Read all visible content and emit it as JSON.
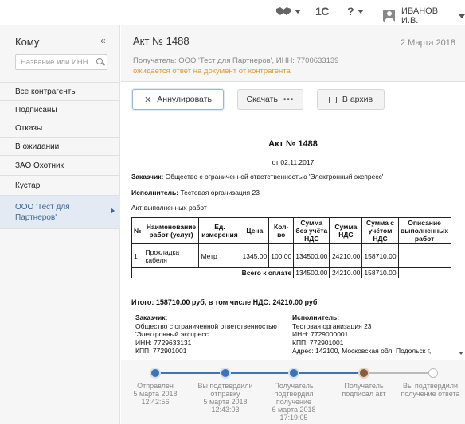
{
  "topbar": {
    "logo_1c": "1С",
    "help": "?",
    "user_name": "ИВАНОВ И.В."
  },
  "sidebar": {
    "title": "Кому",
    "collapse_icon": "«",
    "search_placeholder": "Название или ИНН",
    "items": [
      {
        "label": "Все контрагенты"
      },
      {
        "label": "Подписаны"
      },
      {
        "label": "Отказы"
      },
      {
        "label": "В ожидании"
      },
      {
        "label": "ЗАО Охотник"
      },
      {
        "label": "Кустар"
      },
      {
        "label": "ООО 'Тест для Партнеров'"
      }
    ]
  },
  "header": {
    "title": "Акт № 1488",
    "date": "2 Марта 2018",
    "recipient": "Получатель: ООО 'Тест для Партнеров', ИНН: 7700633139",
    "status": "ожидается ответ на документ от контрагента"
  },
  "actions": {
    "annul": "Аннулировать",
    "download": "Скачать",
    "archive": "В архив"
  },
  "document": {
    "title": "Акт № 1488",
    "date_line": "от 02.11.2017",
    "customer_label": "Заказчик:",
    "customer_value": "Общество с ограниченной ответственностью 'Электронный экспресс'",
    "executor_label": "Исполнитель:",
    "executor_value": "Тестовая организация 23",
    "subtitle": "Акт выполненных работ",
    "table": {
      "headers": [
        "№",
        "Наименование работ (услуг)",
        "Ед. измерения",
        "Цена",
        "Кол-во",
        "Сумма без учёта НДС",
        "Сумма НДС",
        "Сумма с учётом НДС",
        "Описание выполненных работ"
      ],
      "rows": [
        [
          "1",
          "Прокладка кабеля",
          "Метр",
          "1345.00",
          "100.00",
          "134500.00",
          "24210.00",
          "158710.00",
          ""
        ]
      ],
      "total_label": "Всего к оплате",
      "total_no_vat": "134500.00",
      "total_vat": "24210.00",
      "total_with_vat": "158710.00"
    },
    "grand_total": "Итого: 158710.00 руб, в том числе НДС: 24210.00 руб",
    "customer_block": {
      "label": "Заказчик:",
      "name1": "Общество с ограниченной ответственностью",
      "name2": "'Электронный экспресс'",
      "inn": "ИНН: 7729633131",
      "kpp": "КПП: 772901001"
    },
    "executor_block": {
      "label": "Исполнитель:",
      "name": "Тестовая организация 23",
      "inn": "ИНН: 7729000001",
      "kpp": "КПП: 772901001",
      "address": "Адрес: 142100, Московская обл, Подольск г,"
    }
  },
  "timeline": {
    "steps": [
      {
        "l1": "Отправлен",
        "l2": "5 марта 2018",
        "l3": "12:42:56",
        "l4": "",
        "state": "done"
      },
      {
        "l1": "Вы подтвердили",
        "l2": "отправку",
        "l3": "5 марта 2018",
        "l4": "12:43:03",
        "state": "done"
      },
      {
        "l1": "Получатель",
        "l2": "подтвердил",
        "l3": "получение",
        "l4": "6 марта 2018",
        "l5": "17:19:05",
        "state": "done"
      },
      {
        "l1": "Получатель",
        "l2": "подписал акт",
        "l3": "",
        "l4": "",
        "state": "current"
      },
      {
        "l1": "Вы подтвердили",
        "l2": "получение ответа",
        "l3": "",
        "l4": "",
        "state": "pending"
      }
    ]
  },
  "colors": {
    "accent_blue": "#3f73b8",
    "status_orange": "#e49a2a",
    "current_step": "#8a5a3c",
    "sidebar_selected": "#e4eaf3"
  }
}
